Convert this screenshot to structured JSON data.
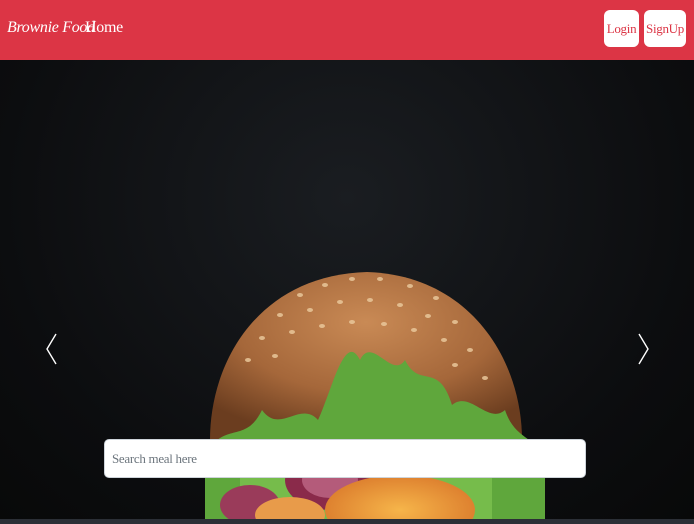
{
  "navbar": {
    "brand": "Brownie Food",
    "home_label": "Home",
    "login_label": "Login",
    "signup_label": "SignUp",
    "background_color": "#dc3545"
  },
  "carousel": {
    "image_subject": "burger",
    "prev_icon": "chevron-left-icon",
    "next_icon": "chevron-right-icon"
  },
  "search": {
    "placeholder": "Search meal here",
    "value": ""
  }
}
